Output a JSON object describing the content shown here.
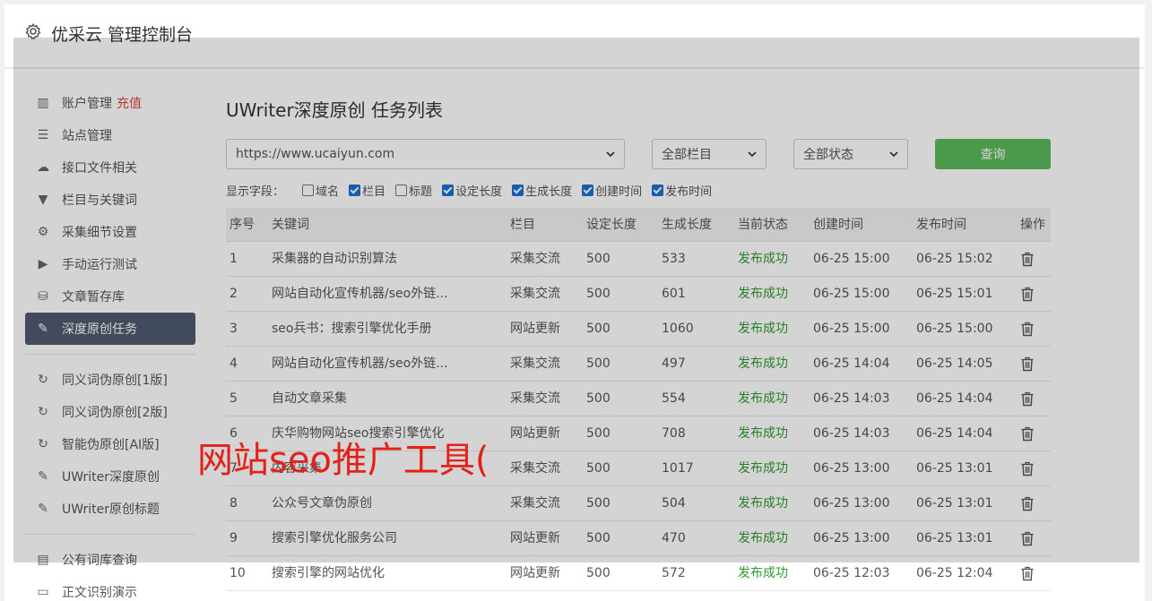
{
  "header": {
    "title": "优采云 管理控制台"
  },
  "sidebar": {
    "items": [
      {
        "label": "账户管理",
        "extra": "充值",
        "icon": "bar-chart-icon"
      },
      {
        "label": "站点管理",
        "icon": "server-icon"
      },
      {
        "label": "接口文件相关",
        "icon": "cloud-upload-icon"
      },
      {
        "label": "栏目与关键词",
        "icon": "filter-icon"
      },
      {
        "label": "采集细节设置",
        "icon": "gears-icon"
      },
      {
        "label": "手动运行测试",
        "icon": "play-circle-icon"
      },
      {
        "label": "文章暂存库",
        "icon": "database-icon"
      },
      {
        "label": "深度原创任务",
        "icon": "edit-icon",
        "active": true
      }
    ],
    "items2": [
      {
        "label": "同义词伪原创[1版]",
        "icon": "refresh-icon"
      },
      {
        "label": "同义词伪原创[2版]",
        "icon": "refresh-icon"
      },
      {
        "label": "智能伪原创[AI版]",
        "icon": "refresh-icon"
      },
      {
        "label": "UWriter深度原创",
        "icon": "edit-icon"
      },
      {
        "label": "UWriter原创标题",
        "icon": "edit-icon"
      }
    ],
    "items3": [
      {
        "label": "公有词库查询",
        "icon": "book-icon"
      },
      {
        "label": "正文识别演示",
        "icon": "monitor-icon"
      }
    ]
  },
  "main": {
    "title": "UWriter深度原创 任务列表",
    "site_select": "https://www.ucaiyun.com",
    "column_select": "全部栏目",
    "status_select": "全部状态",
    "query_label": "查询",
    "fields_label": "显示字段：",
    "fields": [
      {
        "label": "域名",
        "checked": false
      },
      {
        "label": "栏目",
        "checked": true
      },
      {
        "label": "标题",
        "checked": false
      },
      {
        "label": "设定长度",
        "checked": true
      },
      {
        "label": "生成长度",
        "checked": true
      },
      {
        "label": "创建时间",
        "checked": true
      },
      {
        "label": "发布时间",
        "checked": true
      }
    ]
  },
  "table": {
    "headers": [
      "序号",
      "关键词",
      "栏目",
      "设定长度",
      "生成长度",
      "当前状态",
      "创建时间",
      "发布时间",
      "操作"
    ],
    "rows": [
      [
        "1",
        "采集器的自动识别算法",
        "采集交流",
        "500",
        "533",
        "发布成功",
        "06-25 15:00",
        "06-25 15:02"
      ],
      [
        "2",
        "网站自动化宣传机器/seo外链...",
        "采集交流",
        "500",
        "601",
        "发布成功",
        "06-25 15:00",
        "06-25 15:01"
      ],
      [
        "3",
        "seo兵书：搜索引擎优化手册",
        "网站更新",
        "500",
        "1060",
        "发布成功",
        "06-25 15:00",
        "06-25 15:00"
      ],
      [
        "4",
        "网站自动化宣传机器/seo外链...",
        "采集交流",
        "500",
        "497",
        "发布成功",
        "06-25 14:04",
        "06-25 14:05"
      ],
      [
        "5",
        "自动文章采集",
        "采集交流",
        "500",
        "554",
        "发布成功",
        "06-25 14:03",
        "06-25 14:04"
      ],
      [
        "6",
        "庆华购物网站seo搜索引擎优化",
        "网站更新",
        "500",
        "708",
        "发布成功",
        "06-25 14:03",
        "06-25 14:04"
      ],
      [
        "7",
        "内容采集",
        "采集交流",
        "500",
        "1017",
        "发布成功",
        "06-25 13:00",
        "06-25 13:01"
      ],
      [
        "8",
        "公众号文章伪原创",
        "采集交流",
        "500",
        "504",
        "发布成功",
        "06-25 13:00",
        "06-25 13:01"
      ],
      [
        "9",
        "搜索引擎优化服务公司",
        "网站更新",
        "500",
        "470",
        "发布成功",
        "06-25 13:00",
        "06-25 13:01"
      ],
      [
        "10",
        "搜索引擎的网站优化",
        "网站更新",
        "500",
        "572",
        "发布成功",
        "06-25 12:03",
        "06-25 12:04"
      ]
    ]
  },
  "watermark": "网站seo推广工具(",
  "colors": {
    "accent": "#5cb85c",
    "active_nav": "#505b6e",
    "success": "#2e9a2e",
    "watermark": "#e4201a"
  }
}
